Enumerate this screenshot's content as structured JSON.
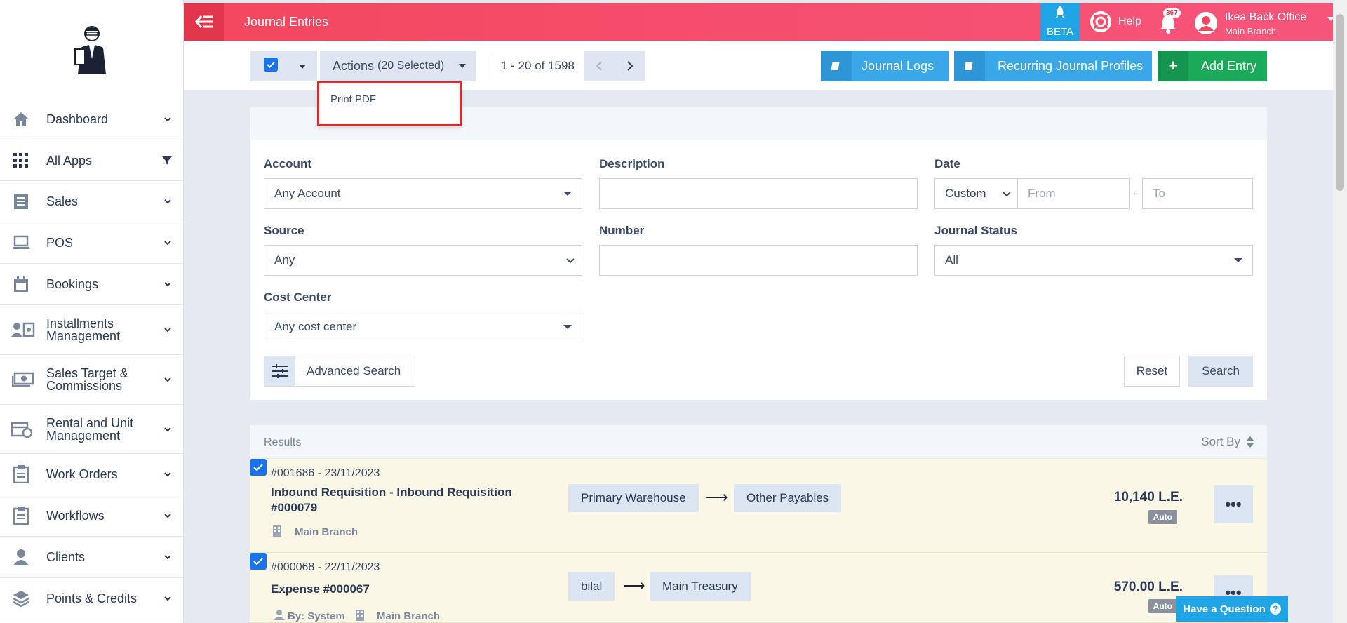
{
  "sidebar": {
    "items": [
      {
        "label": "Dashboard",
        "icon": "home-icon"
      },
      {
        "label": "All Apps",
        "icon": "grid-icon"
      },
      {
        "label": "Sales",
        "icon": "receipt-icon"
      },
      {
        "label": "POS",
        "icon": "laptop-icon"
      },
      {
        "label": "Bookings",
        "icon": "calendar-icon"
      },
      {
        "label": "Installments Management",
        "icon": "installments-icon"
      },
      {
        "label": "Sales Target & Commissions",
        "icon": "money-icon"
      },
      {
        "label": "Rental and Unit Management",
        "icon": "rental-icon"
      },
      {
        "label": "Work Orders",
        "icon": "clipboard-icon"
      },
      {
        "label": "Workflows",
        "icon": "clipboard-icon"
      },
      {
        "label": "Clients",
        "icon": "user-icon"
      },
      {
        "label": "Points & Credits",
        "icon": "layers-icon"
      }
    ]
  },
  "topbar": {
    "title": "Journal Entries",
    "beta": "BETA",
    "help": "Help",
    "notifications": "367",
    "user_name": "Ikea Back Office",
    "user_branch": "Main Branch"
  },
  "toolbar": {
    "actions_label": "Actions",
    "actions_count": "(20 Selected)",
    "pager": "1 - 20 of 1598",
    "journal_logs": "Journal Logs",
    "recurring_profiles": "Recurring Journal Profiles",
    "add_entry": "Add Entry"
  },
  "dropdown": {
    "print_pdf": "Print PDF"
  },
  "filters": {
    "account_label": "Account",
    "account_value": "Any Account",
    "description_label": "Description",
    "date_label": "Date",
    "date_mode": "Custom",
    "date_from_ph": "From",
    "date_sep": "-",
    "date_to_ph": "To",
    "source_label": "Source",
    "source_value": "Any",
    "number_label": "Number",
    "status_label": "Journal Status",
    "status_value": "All",
    "cost_center_label": "Cost Center",
    "cost_center_value": "Any cost center",
    "advanced": "Advanced Search",
    "reset": "Reset",
    "search": "Search"
  },
  "results": {
    "title": "Results",
    "sort_by": "Sort By",
    "rows": [
      {
        "ref": "#001686 - 23/11/2023",
        "title_line1": "Inbound Requisition - Inbound Requisition",
        "title_line2": "#000079",
        "by": "",
        "branch": "Main Branch",
        "from": "Primary Warehouse",
        "to": "Other Payables",
        "amount": "10,140 L.E.",
        "badge": "Auto"
      },
      {
        "ref": "#000068 - 22/11/2023",
        "title_line1": "Expense #000067",
        "title_line2": "",
        "by": "By: System",
        "branch": "Main Branch",
        "from": "bilal",
        "to": "Main Treasury",
        "amount": "570.00 L.E.",
        "badge": "Auto"
      }
    ]
  },
  "help_widget": "Have a Question",
  "colors": {
    "brand": "#f4475f",
    "accent_blue": "#1fa5e6",
    "add_green": "#1aaa5a",
    "row_selected": "#fbf7e6"
  }
}
